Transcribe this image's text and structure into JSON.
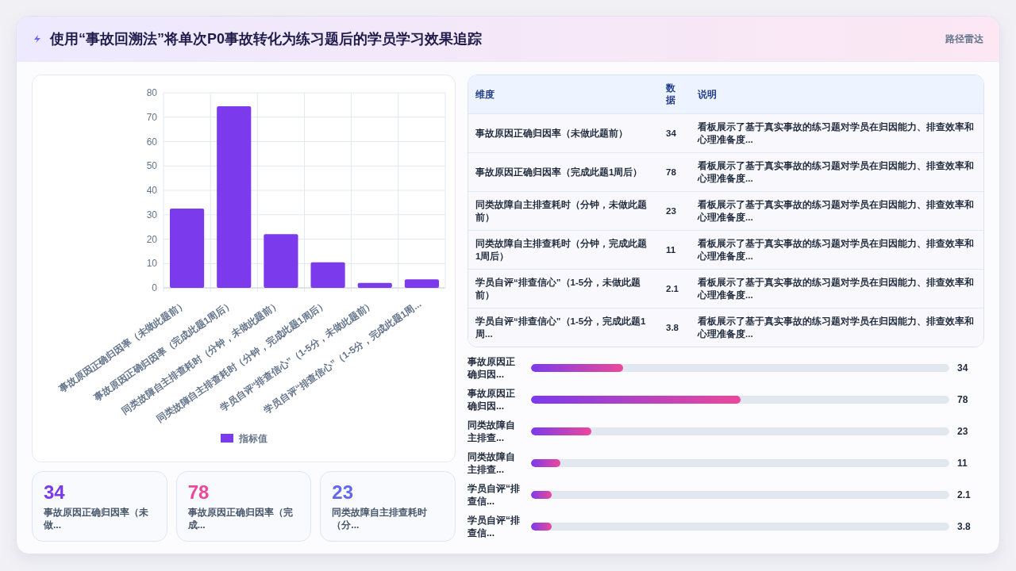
{
  "header": {
    "title": "使用“事故回溯法”将单次P0事故转化为练习题后的学员学习效果追踪",
    "badge": "路径雷达"
  },
  "chart_data": {
    "type": "bar",
    "categories": [
      "事故原因正确归因率（未做此题前）",
      "事故原因正确归因率（完成此题1周后）",
      "同类故障自主排查耗时（分钟，未做此题前）",
      "同类故障自主排查耗时（分钟，完成此题1周后）",
      "学员自评“排查信心”（1-5分，未做此题前）",
      "学员自评“排查信心”（1-5分，完成此题1周..."
    ],
    "series": [
      {
        "name": "指标值",
        "color": "#7c3aed",
        "values": [
          32.5,
          74.5,
          22,
          10.5,
          2,
          3.5
        ]
      }
    ],
    "grid": true,
    "ylim": [
      0,
      80
    ],
    "yticks": [
      0,
      10,
      20,
      30,
      40,
      50,
      60,
      70,
      80
    ]
  },
  "kpis": [
    {
      "value": "34",
      "label": "事故原因正确归因率（未做...",
      "color": "#7c3aed"
    },
    {
      "value": "78",
      "label": "事故原因正确归因率（完成...",
      "color": "#ec4899"
    },
    {
      "value": "23",
      "label": "同类故障自主排查耗时（分...",
      "color": "#6366f1"
    }
  ],
  "table": {
    "columns": [
      "维度",
      "数据",
      "说明"
    ],
    "rows": [
      [
        "事故原因正确归因率（未做此题前）",
        "34",
        "看板展示了基于真实事故的练习题对学员在归因能力、排查效率和心理准备度..."
      ],
      [
        "事故原因正确归因率（完成此题1周后）",
        "78",
        "看板展示了基于真实事故的练习题对学员在归因能力、排查效率和心理准备度..."
      ],
      [
        "同类故障自主排查耗时（分钟，未做此题前）",
        "23",
        "看板展示了基于真实事故的练习题对学员在归因能力、排查效率和心理准备度..."
      ],
      [
        "同类故障自主排查耗时（分钟，完成此题1周后）",
        "11",
        "看板展示了基于真实事故的练习题对学员在归因能力、排查效率和心理准备度..."
      ],
      [
        "学员自评“排查信心”（1-5分，未做此题前）",
        "2.1",
        "看板展示了基于真实事故的练习题对学员在归因能力、排查效率和心理准备度..."
      ],
      [
        "学员自评“排查信心”（1-5分，完成此题1周...",
        "3.8",
        "看板展示了基于真实事故的练习题对学员在归因能力、排查效率和心理准备度..."
      ]
    ]
  },
  "bars": [
    {
      "label": "事故原因正确归因...",
      "value": "34",
      "level": 0.22
    },
    {
      "label": "事故原因正确归因...",
      "value": "78",
      "level": 0.5
    },
    {
      "label": "同类故障自主排查...",
      "value": "23",
      "level": 0.145
    },
    {
      "label": "同类故障自主排查...",
      "value": "11",
      "level": 0.07
    },
    {
      "label": "学员自评“排查信...",
      "value": "2.1",
      "level": 0.05
    },
    {
      "label": "学员自评“排查信...",
      "value": "3.8",
      "level": 0.05
    }
  ]
}
